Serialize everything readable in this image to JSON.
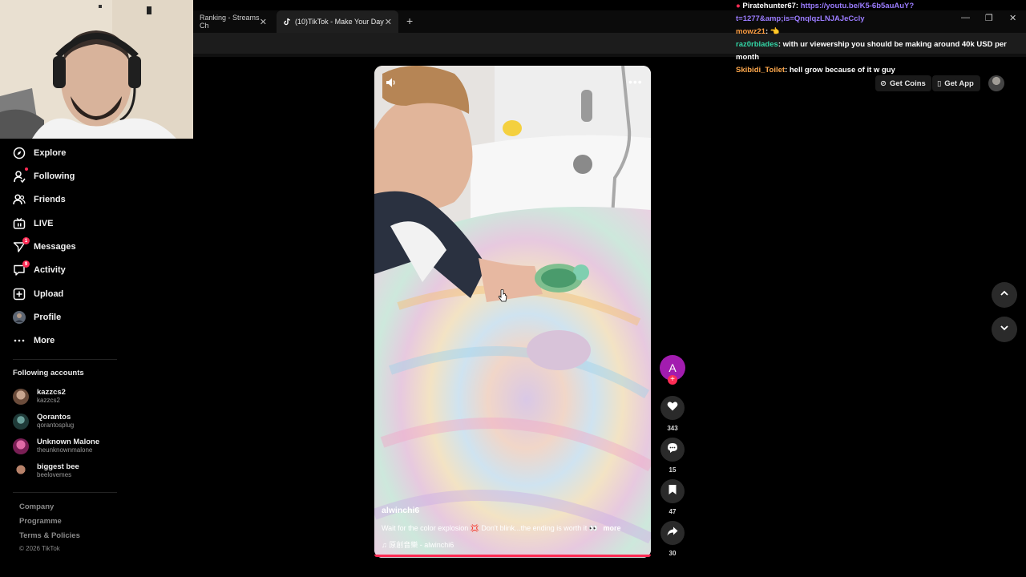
{
  "browser": {
    "tabs": [
      {
        "label": "Ranking - Streams Ch",
        "active": false
      },
      {
        "label": "(10)TikTok - Make Your Day",
        "active": true
      }
    ],
    "new_tab": "+",
    "close": "✕",
    "window_controls": [
      "—",
      "❐",
      "✕"
    ]
  },
  "chat": [
    {
      "user": "Piratehunter67",
      "text": "https://youtu.be/K5-6b5auAuY?t=1277&amp;is=QnqlqzLNJAJeCcly",
      "user_color": "#ffffff"
    },
    {
      "user": "mowz21",
      "text": "👈",
      "user_color": "#ff9f43"
    },
    {
      "user": "raz0rblades",
      "text": "with ur viewership you should be making around 40k USD per month",
      "user_color": "#33d6a6"
    },
    {
      "user": "Skibidi_Toilet",
      "text": "hell grow because of it w guy",
      "user_color": "#ffa94d"
    }
  ],
  "header": {
    "get_coins": "Get Coins",
    "get_app": "Get App"
  },
  "sidebar": {
    "items": [
      {
        "label": "Explore",
        "icon": "compass-icon"
      },
      {
        "label": "Following",
        "icon": "user-follow-icon"
      },
      {
        "label": "Friends",
        "icon": "friends-icon"
      },
      {
        "label": "LIVE",
        "icon": "live-icon"
      },
      {
        "label": "Messages",
        "icon": "send-icon",
        "badge": "1"
      },
      {
        "label": "Activity",
        "icon": "activity-icon",
        "badge": "9"
      },
      {
        "label": "Upload",
        "icon": "upload-icon"
      },
      {
        "label": "Profile",
        "icon": "profile-avatar-icon"
      },
      {
        "label": "More",
        "icon": "more-dots-icon"
      }
    ],
    "following_title": "Following accounts",
    "accounts": [
      {
        "name": "kazzcs2",
        "handle": "kazzcs2"
      },
      {
        "name": "Qorantos",
        "handle": "qorantosplug"
      },
      {
        "name": "Unknown Malone",
        "handle": "theunknownmalone"
      },
      {
        "name": "biggest bee",
        "handle": "beelovemes"
      }
    ],
    "footer": [
      "Company",
      "Programme",
      "Terms & Policies"
    ],
    "copyright": "© 2026 TikTok"
  },
  "video": {
    "handle": "alwinchi6",
    "caption": "Wait for the color explosion 💢 Don't blink...the ending is worth it 👀",
    "more": "more",
    "sound": "♫  原創音樂 - alwinchi6",
    "creator_initial": "A",
    "progress": 1.0
  },
  "actions": {
    "likes": "343",
    "comments": "15",
    "saves": "47",
    "shares": "30"
  },
  "colors": {
    "accent": "#fe2c55",
    "creator_avatar": "#a21caf",
    "background": "#000000"
  }
}
